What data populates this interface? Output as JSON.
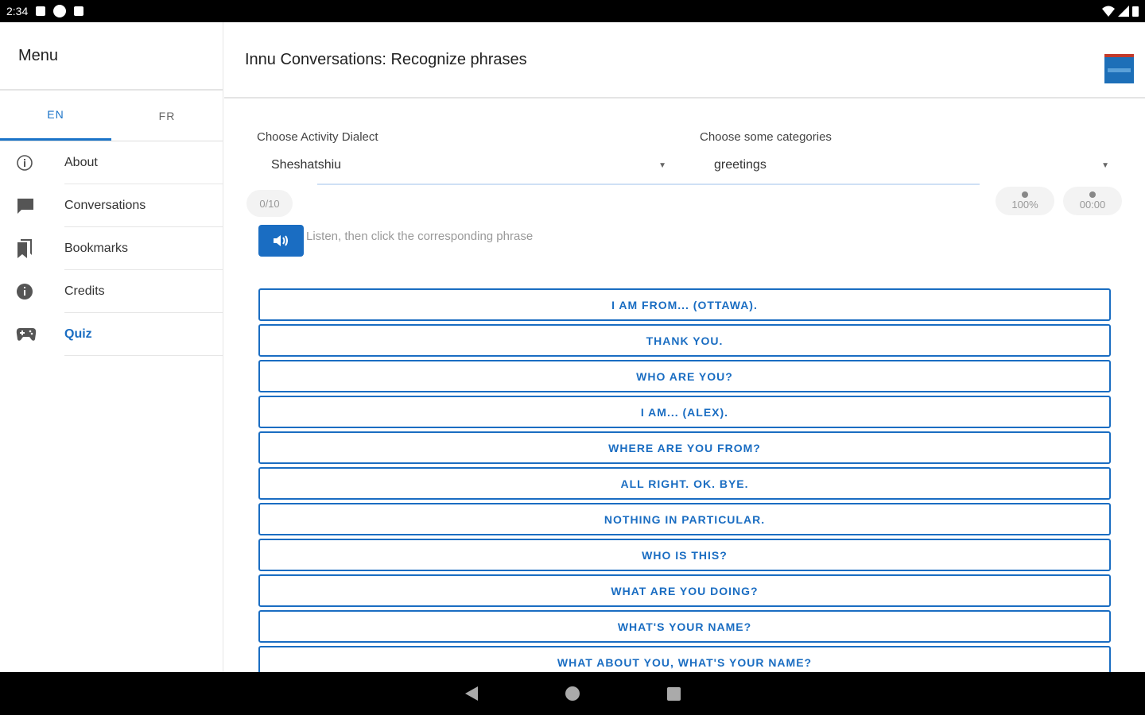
{
  "status_bar": {
    "time": "2:34"
  },
  "sidebar": {
    "title": "Menu",
    "tabs": [
      {
        "label": "EN",
        "active": true
      },
      {
        "label": "FR",
        "active": false
      }
    ],
    "items": [
      {
        "label": "About",
        "icon": "info-outline-icon"
      },
      {
        "label": "Conversations",
        "icon": "chat-bubble-icon"
      },
      {
        "label": "Bookmarks",
        "icon": "bookmarks-icon"
      },
      {
        "label": "Credits",
        "icon": "info-filled-icon"
      },
      {
        "label": "Quiz",
        "icon": "gamepad-icon",
        "active": true
      }
    ]
  },
  "header": {
    "title": "Innu Conversations: Recognize phrases"
  },
  "filters": {
    "dialect": {
      "label": "Choose Activity Dialect",
      "value": "Sheshatshiu"
    },
    "categories": {
      "label": "Choose some categories",
      "value": "greetings"
    }
  },
  "progress": {
    "count": "0/10",
    "percent": "100%",
    "time": "00:00"
  },
  "quiz": {
    "instruction": "Listen, then click the corresponding phrase",
    "answers": [
      "I AM FROM... (OTTAWA).",
      "THANK YOU.",
      "WHO ARE YOU?",
      "I AM... (ALEX).",
      "WHERE ARE YOU FROM?",
      "ALL RIGHT. OK. BYE.",
      "NOTHING IN PARTICULAR.",
      "WHO IS THIS?",
      "WHAT ARE YOU DOING?",
      "WHAT'S YOUR NAME?",
      "WHAT ABOUT YOU, WHAT'S YOUR NAME?"
    ]
  },
  "colors": {
    "accent": "#1a6dc2",
    "divider": "#e6e6e6"
  }
}
